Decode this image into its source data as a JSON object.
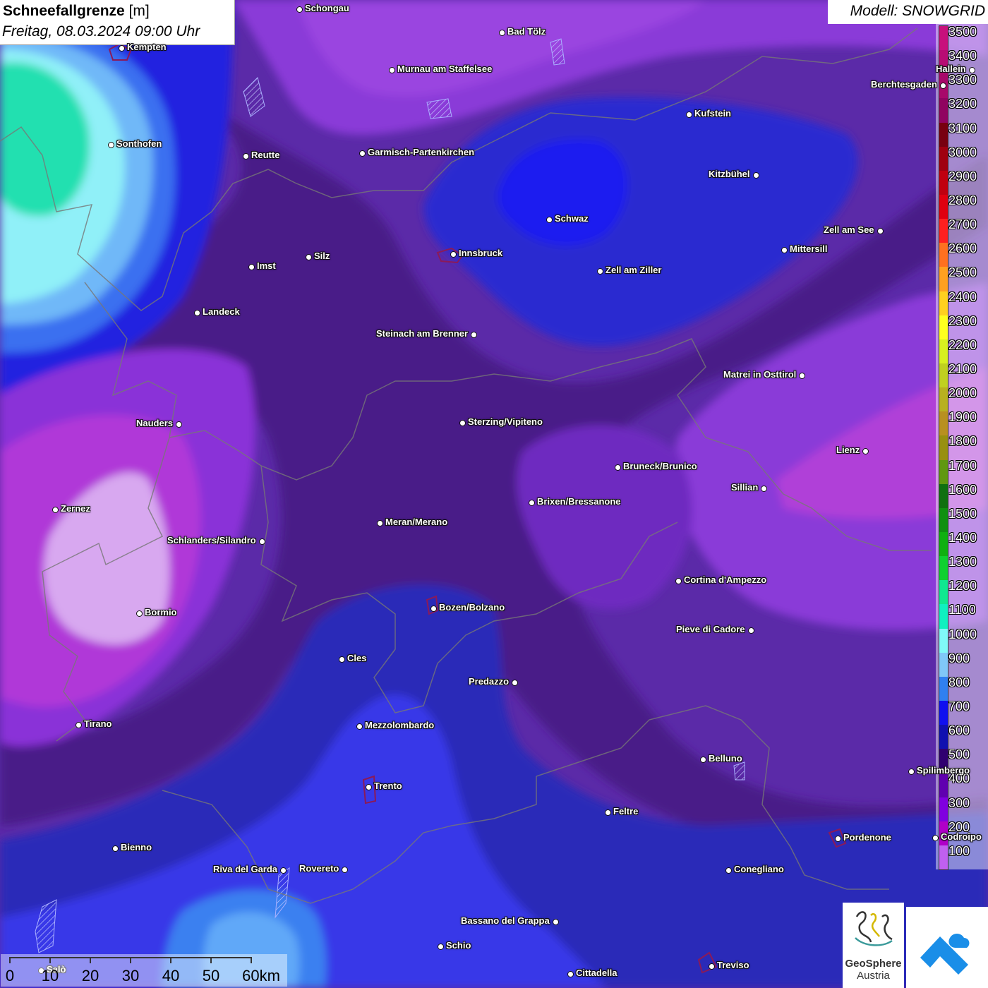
{
  "title": {
    "parameter": "Schneefallgrenze",
    "unit": "[m]",
    "datetime": "Freitag, 08.03.2024 09:00 Uhr"
  },
  "model": "Modell: SNOWGRID",
  "legend": [
    {
      "label": "3500",
      "color": "#c8107c"
    },
    {
      "label": "3400",
      "color": "#b80c74"
    },
    {
      "label": "3300",
      "color": "#a8086a"
    },
    {
      "label": "3200",
      "color": "#900460"
    },
    {
      "label": "3100",
      "color": "#780010"
    },
    {
      "label": "3000",
      "color": "#a00010"
    },
    {
      "label": "2900",
      "color": "#c00010"
    },
    {
      "label": "2800",
      "color": "#e00010"
    },
    {
      "label": "2700",
      "color": "#ff2020"
    },
    {
      "label": "2600",
      "color": "#ff7020"
    },
    {
      "label": "2500",
      "color": "#ffa020"
    },
    {
      "label": "2400",
      "color": "#ffd020"
    },
    {
      "label": "2300",
      "color": "#ffff20"
    },
    {
      "label": "2200",
      "color": "#d8f020"
    },
    {
      "label": "2100",
      "color": "#c0d020"
    },
    {
      "label": "2000",
      "color": "#b8b020"
    },
    {
      "label": "1900",
      "color": "#b89020"
    },
    {
      "label": "1800",
      "color": "#989010"
    },
    {
      "label": "1700",
      "color": "#609810"
    },
    {
      "label": "1600",
      "color": "#107010"
    },
    {
      "label": "1500",
      "color": "#109010"
    },
    {
      "label": "1400",
      "color": "#10b010"
    },
    {
      "label": "1300",
      "color": "#10d030"
    },
    {
      "label": "1200",
      "color": "#10e890"
    },
    {
      "label": "1100",
      "color": "#10f0c0"
    },
    {
      "label": "1000",
      "color": "#80f8f8"
    },
    {
      "label": "900",
      "color": "#80c8f8"
    },
    {
      "label": "800",
      "color": "#3080f0"
    },
    {
      "label": "700",
      "color": "#1010f0"
    },
    {
      "label": "600",
      "color": "#1010b0"
    },
    {
      "label": "500",
      "color": "#300070"
    },
    {
      "label": "400",
      "color": "#6000b0"
    },
    {
      "label": "300",
      "color": "#8000e0"
    },
    {
      "label": "200",
      "color": "#b000c8"
    },
    {
      "label": "100",
      "color": "#c060f0"
    }
  ],
  "cities": [
    {
      "name": "Schongau"
    },
    {
      "name": "Bad Tölz"
    },
    {
      "name": "Kempten"
    },
    {
      "name": "Murnau am Staffelsee"
    },
    {
      "name": "Hallein"
    },
    {
      "name": "Berchtesgaden"
    },
    {
      "name": "Kufstein"
    },
    {
      "name": "Sonthofen"
    },
    {
      "name": "Reutte"
    },
    {
      "name": "Garmisch-Partenkirchen"
    },
    {
      "name": "Kitzbühel"
    },
    {
      "name": "Schwaz"
    },
    {
      "name": "Zell am See"
    },
    {
      "name": "Innsbruck"
    },
    {
      "name": "Mittersill"
    },
    {
      "name": "Silz"
    },
    {
      "name": "Imst"
    },
    {
      "name": "Zell am Ziller"
    },
    {
      "name": "Landeck"
    },
    {
      "name": "Steinach am Brenner"
    },
    {
      "name": "Matrei in Osttirol"
    },
    {
      "name": "Nauders"
    },
    {
      "name": "Sterzing/Vipiteno"
    },
    {
      "name": "Lienz"
    },
    {
      "name": "Bruneck/Brunico"
    },
    {
      "name": "Sillian"
    },
    {
      "name": "Brixen/Bressanone"
    },
    {
      "name": "Zernez"
    },
    {
      "name": "Meran/Merano"
    },
    {
      "name": "Schlanders/Silandro"
    },
    {
      "name": "Cortina d'Ampezzo"
    },
    {
      "name": "Bozen/Bolzano"
    },
    {
      "name": "Bormio"
    },
    {
      "name": "Pieve di Cadore"
    },
    {
      "name": "Cles"
    },
    {
      "name": "Predazzo"
    },
    {
      "name": "Tirano"
    },
    {
      "name": "Mezzolombardo"
    },
    {
      "name": "Belluno"
    },
    {
      "name": "Spilimbergo"
    },
    {
      "name": "Trento"
    },
    {
      "name": "Feltre"
    },
    {
      "name": "Pordenone"
    },
    {
      "name": "Codroipo"
    },
    {
      "name": "Bienno"
    },
    {
      "name": "Riva del Garda"
    },
    {
      "name": "Rovereto"
    },
    {
      "name": "Conegliano"
    },
    {
      "name": "Bassano del Grappa"
    },
    {
      "name": "Schio"
    },
    {
      "name": "Treviso"
    },
    {
      "name": "Salò"
    },
    {
      "name": "Cittadella"
    }
  ],
  "scalebar": {
    "labels": [
      "0",
      "10",
      "20",
      "30",
      "40",
      "50",
      "60km"
    ]
  },
  "logos": {
    "geosphere_line1": "GeoSphere",
    "geosphere_line2": "Austria"
  }
}
